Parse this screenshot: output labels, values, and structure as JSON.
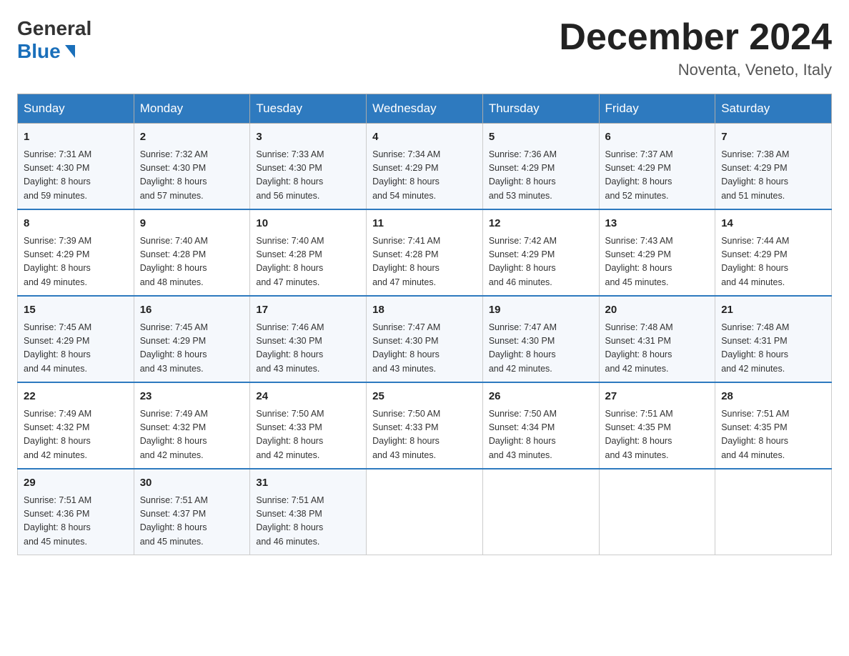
{
  "header": {
    "logo_general": "General",
    "logo_blue": "Blue",
    "month_title": "December 2024",
    "location": "Noventa, Veneto, Italy"
  },
  "days_of_week": [
    "Sunday",
    "Monday",
    "Tuesday",
    "Wednesday",
    "Thursday",
    "Friday",
    "Saturday"
  ],
  "weeks": [
    [
      {
        "day": "1",
        "sunrise": "7:31 AM",
        "sunset": "4:30 PM",
        "daylight": "8 hours and 59 minutes."
      },
      {
        "day": "2",
        "sunrise": "7:32 AM",
        "sunset": "4:30 PM",
        "daylight": "8 hours and 57 minutes."
      },
      {
        "day": "3",
        "sunrise": "7:33 AM",
        "sunset": "4:30 PM",
        "daylight": "8 hours and 56 minutes."
      },
      {
        "day": "4",
        "sunrise": "7:34 AM",
        "sunset": "4:29 PM",
        "daylight": "8 hours and 54 minutes."
      },
      {
        "day": "5",
        "sunrise": "7:36 AM",
        "sunset": "4:29 PM",
        "daylight": "8 hours and 53 minutes."
      },
      {
        "day": "6",
        "sunrise": "7:37 AM",
        "sunset": "4:29 PM",
        "daylight": "8 hours and 52 minutes."
      },
      {
        "day": "7",
        "sunrise": "7:38 AM",
        "sunset": "4:29 PM",
        "daylight": "8 hours and 51 minutes."
      }
    ],
    [
      {
        "day": "8",
        "sunrise": "7:39 AM",
        "sunset": "4:29 PM",
        "daylight": "8 hours and 49 minutes."
      },
      {
        "day": "9",
        "sunrise": "7:40 AM",
        "sunset": "4:28 PM",
        "daylight": "8 hours and 48 minutes."
      },
      {
        "day": "10",
        "sunrise": "7:40 AM",
        "sunset": "4:28 PM",
        "daylight": "8 hours and 47 minutes."
      },
      {
        "day": "11",
        "sunrise": "7:41 AM",
        "sunset": "4:28 PM",
        "daylight": "8 hours and 47 minutes."
      },
      {
        "day": "12",
        "sunrise": "7:42 AM",
        "sunset": "4:29 PM",
        "daylight": "8 hours and 46 minutes."
      },
      {
        "day": "13",
        "sunrise": "7:43 AM",
        "sunset": "4:29 PM",
        "daylight": "8 hours and 45 minutes."
      },
      {
        "day": "14",
        "sunrise": "7:44 AM",
        "sunset": "4:29 PM",
        "daylight": "8 hours and 44 minutes."
      }
    ],
    [
      {
        "day": "15",
        "sunrise": "7:45 AM",
        "sunset": "4:29 PM",
        "daylight": "8 hours and 44 minutes."
      },
      {
        "day": "16",
        "sunrise": "7:45 AM",
        "sunset": "4:29 PM",
        "daylight": "8 hours and 43 minutes."
      },
      {
        "day": "17",
        "sunrise": "7:46 AM",
        "sunset": "4:30 PM",
        "daylight": "8 hours and 43 minutes."
      },
      {
        "day": "18",
        "sunrise": "7:47 AM",
        "sunset": "4:30 PM",
        "daylight": "8 hours and 43 minutes."
      },
      {
        "day": "19",
        "sunrise": "7:47 AM",
        "sunset": "4:30 PM",
        "daylight": "8 hours and 42 minutes."
      },
      {
        "day": "20",
        "sunrise": "7:48 AM",
        "sunset": "4:31 PM",
        "daylight": "8 hours and 42 minutes."
      },
      {
        "day": "21",
        "sunrise": "7:48 AM",
        "sunset": "4:31 PM",
        "daylight": "8 hours and 42 minutes."
      }
    ],
    [
      {
        "day": "22",
        "sunrise": "7:49 AM",
        "sunset": "4:32 PM",
        "daylight": "8 hours and 42 minutes."
      },
      {
        "day": "23",
        "sunrise": "7:49 AM",
        "sunset": "4:32 PM",
        "daylight": "8 hours and 42 minutes."
      },
      {
        "day": "24",
        "sunrise": "7:50 AM",
        "sunset": "4:33 PM",
        "daylight": "8 hours and 42 minutes."
      },
      {
        "day": "25",
        "sunrise": "7:50 AM",
        "sunset": "4:33 PM",
        "daylight": "8 hours and 43 minutes."
      },
      {
        "day": "26",
        "sunrise": "7:50 AM",
        "sunset": "4:34 PM",
        "daylight": "8 hours and 43 minutes."
      },
      {
        "day": "27",
        "sunrise": "7:51 AM",
        "sunset": "4:35 PM",
        "daylight": "8 hours and 43 minutes."
      },
      {
        "day": "28",
        "sunrise": "7:51 AM",
        "sunset": "4:35 PM",
        "daylight": "8 hours and 44 minutes."
      }
    ],
    [
      {
        "day": "29",
        "sunrise": "7:51 AM",
        "sunset": "4:36 PM",
        "daylight": "8 hours and 45 minutes."
      },
      {
        "day": "30",
        "sunrise": "7:51 AM",
        "sunset": "4:37 PM",
        "daylight": "8 hours and 45 minutes."
      },
      {
        "day": "31",
        "sunrise": "7:51 AM",
        "sunset": "4:38 PM",
        "daylight": "8 hours and 46 minutes."
      },
      null,
      null,
      null,
      null
    ]
  ],
  "labels": {
    "sunrise": "Sunrise:",
    "sunset": "Sunset:",
    "daylight": "Daylight:"
  }
}
